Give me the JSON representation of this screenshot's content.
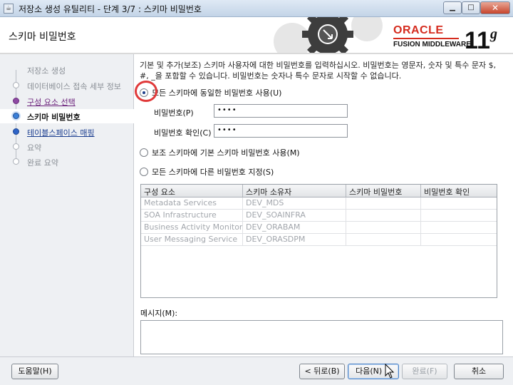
{
  "window": {
    "title": "저장소 생성 유틸리티 - 단계 3/7 : 스키마 비밀번호",
    "icon": "java-icon"
  },
  "header": {
    "page_title": "스키마 비밀번호",
    "logo_oracle": "ORACLE",
    "logo_product": "FUSION MIDDLEWARE",
    "logo_version": "11",
    "logo_version_suffix": "g"
  },
  "nav": {
    "items": [
      {
        "label": "저장소 생성",
        "state": "done"
      },
      {
        "label": "데이터베이스 접속 세부 정보",
        "state": "done"
      },
      {
        "label": "구성 요소 선택",
        "state": "link"
      },
      {
        "label": "스키마 비밀번호",
        "state": "active"
      },
      {
        "label": "테이블스페이스 매핑",
        "state": "link"
      },
      {
        "label": "요약",
        "state": "pending"
      },
      {
        "label": "완료 요약",
        "state": "pending"
      }
    ]
  },
  "content": {
    "description": "기본 및 추가(보조) 스키마 사용자에 대한 비밀번호를 입력하십시오. 비밀번호는 영문자, 숫자 및 특수 문자 $, #, _을 포함할 수 있습니다. 비밀번호는 숫자나 특수 문자로 시작할 수 없습니다.",
    "option_same": "모든 스키마에 동일한 비밀번호 사용(U)",
    "password_label": "비밀번호(P)",
    "password_value": "••••",
    "confirm_label": "비밀번호 확인(C)",
    "confirm_value": "••••",
    "option_aux": "보조 스키마에 기본 스키마 비밀번호 사용(M)",
    "option_diff": "모든 스키마에 다른 비밀번호 지정(S)",
    "selected_option": "same",
    "table": {
      "headers": [
        "구성 요소",
        "스키마 소유자",
        "스키마 비밀번호",
        "비밀번호 확인"
      ],
      "rows": [
        [
          "Metadata Services",
          "DEV_MDS",
          "",
          ""
        ],
        [
          "SOA Infrastructure",
          "DEV_SOAINFRA",
          "",
          ""
        ],
        [
          "Business Activity Monitoring",
          "DEV_ORABAM",
          "",
          ""
        ],
        [
          "User Messaging Service",
          "DEV_ORASDPM",
          "",
          ""
        ]
      ]
    },
    "message_label": "메시지(M):",
    "message_value": ""
  },
  "footer": {
    "help": "도움말(H)",
    "back": "< 뒤로(B)",
    "next": "다음(N) >",
    "finish": "완료(F)",
    "cancel": "취소"
  },
  "colors": {
    "oracle_red": "#d52b1e",
    "accent_blue": "#3a7fd8",
    "link_purple": "#6a1f7a"
  }
}
